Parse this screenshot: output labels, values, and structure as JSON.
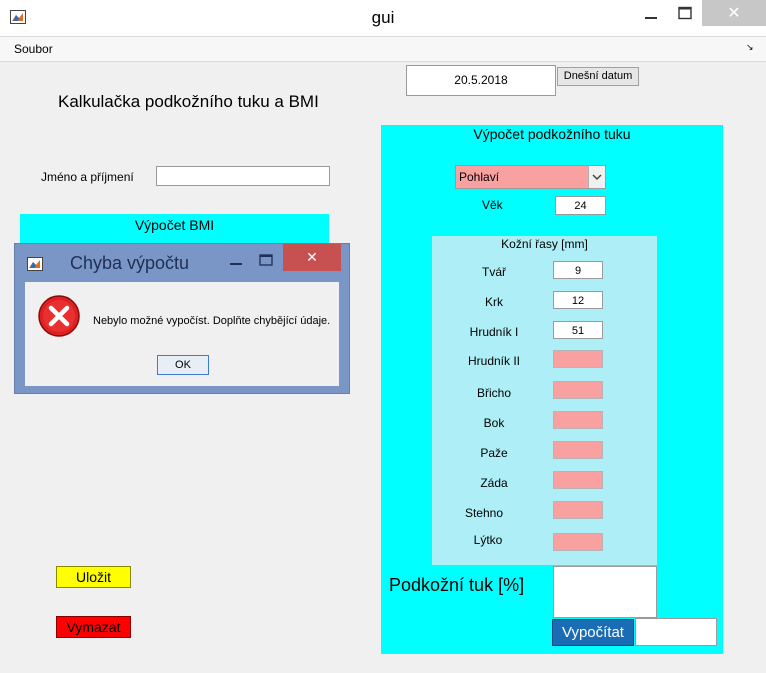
{
  "window": {
    "title": "gui"
  },
  "menu": {
    "file": "Soubor",
    "arrow": "↘"
  },
  "header": {
    "title": "Kalkulačka podkožního tuku a BMI"
  },
  "date": {
    "value": "20.5.2018",
    "today_button": "Dnešní datum"
  },
  "name": {
    "label": "Jméno a příjmení",
    "value": ""
  },
  "bmi": {
    "title": "Výpočet BMI"
  },
  "actions": {
    "save": "Uložit",
    "clear": "Vymazat"
  },
  "fat": {
    "title": "Výpočet podkožního tuku",
    "gender_select": "Pohlaví",
    "age_label": "Věk",
    "age_value": "24",
    "folds_title": "Kožní řasy [mm]",
    "folds": [
      {
        "label": "Tvář",
        "value": "9"
      },
      {
        "label": "Krk",
        "value": "12"
      },
      {
        "label": "Hrudník I",
        "value": "51"
      },
      {
        "label": "Hrudník II",
        "value": ""
      },
      {
        "label": "Břicho",
        "value": ""
      },
      {
        "label": "Bok",
        "value": ""
      },
      {
        "label": "Paže",
        "value": ""
      },
      {
        "label": "Záda",
        "value": ""
      },
      {
        "label": "Stehno",
        "value": ""
      },
      {
        "label": "Lýtko",
        "value": ""
      }
    ],
    "result_label": "Podkožní tuk [%]",
    "result_value": "",
    "compute_button": "Vypočítat",
    "compute_output": ""
  },
  "dialog": {
    "title": "Chyba výpočtu",
    "message": "Nebylo možné vypočíst. Doplňte chybějící údaje.",
    "ok": "OK"
  },
  "colors": {
    "panel": "#00ffff",
    "folds_panel": "#aeeef7",
    "missing": "#f9a0a0",
    "save": "#ffff00",
    "clear": "#ff0000",
    "compute": "#1a6db5"
  }
}
